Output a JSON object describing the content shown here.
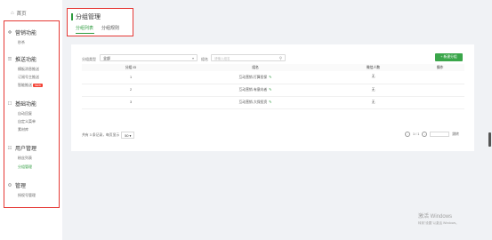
{
  "sidebar": {
    "home": "首页",
    "groups": [
      {
        "title": "营销功能",
        "icon": "marketing-icon",
        "items": [
          {
            "label": "秒杀",
            "active": false
          }
        ]
      },
      {
        "title": "推送功能",
        "icon": "push-icon",
        "items": [
          {
            "label": "模板消息推送",
            "active": false
          },
          {
            "label": "订阅号主推送",
            "active": false
          },
          {
            "label": "智能推送",
            "active": false,
            "badge": "NEW"
          }
        ]
      },
      {
        "title": "基础功能",
        "icon": "basic-icon",
        "items": [
          {
            "label": "自动回复",
            "active": false
          },
          {
            "label": "自定义菜单",
            "active": false
          },
          {
            "label": "素材库",
            "active": false
          }
        ]
      },
      {
        "title": "用户管理",
        "icon": "user-icon",
        "items": [
          {
            "label": "粉丝列表",
            "active": false
          },
          {
            "label": "分组管理",
            "active": true
          }
        ]
      },
      {
        "title": "管理",
        "icon": "manage-icon",
        "items": [
          {
            "label": "授权号管理",
            "active": false
          }
        ]
      }
    ]
  },
  "header": {
    "title": "分组管理",
    "tabs": [
      {
        "label": "分组列表",
        "active": true
      },
      {
        "label": "分组规则",
        "active": false
      }
    ]
  },
  "filters": {
    "type_label": "分组类型",
    "type_value": "全部",
    "name_label": "组名",
    "search_placeholder": "请输入组名"
  },
  "new_button": "+ 新建分组",
  "table": {
    "headers": [
      "分组 ID",
      "组名",
      "微信人数",
      "操作"
    ],
    "rows": [
      [
        "1",
        "互动营销-打算投保",
        "无",
        ""
      ],
      [
        "2",
        "互动营销-有意向者",
        "无",
        ""
      ],
      [
        "3",
        "互动营销-大保投资",
        "无",
        ""
      ]
    ]
  },
  "pagination": {
    "summary": "共有 3 条记录，每页显示",
    "page_size": "50",
    "page_info": "1 / 1",
    "jump_label": "跳转"
  },
  "watermark": {
    "line1": "激活 Windows",
    "line2": "转到\"设置\"以激活 Windows。"
  },
  "colors": {
    "accent": "#2e9b3f",
    "annotation": "#e53935"
  }
}
